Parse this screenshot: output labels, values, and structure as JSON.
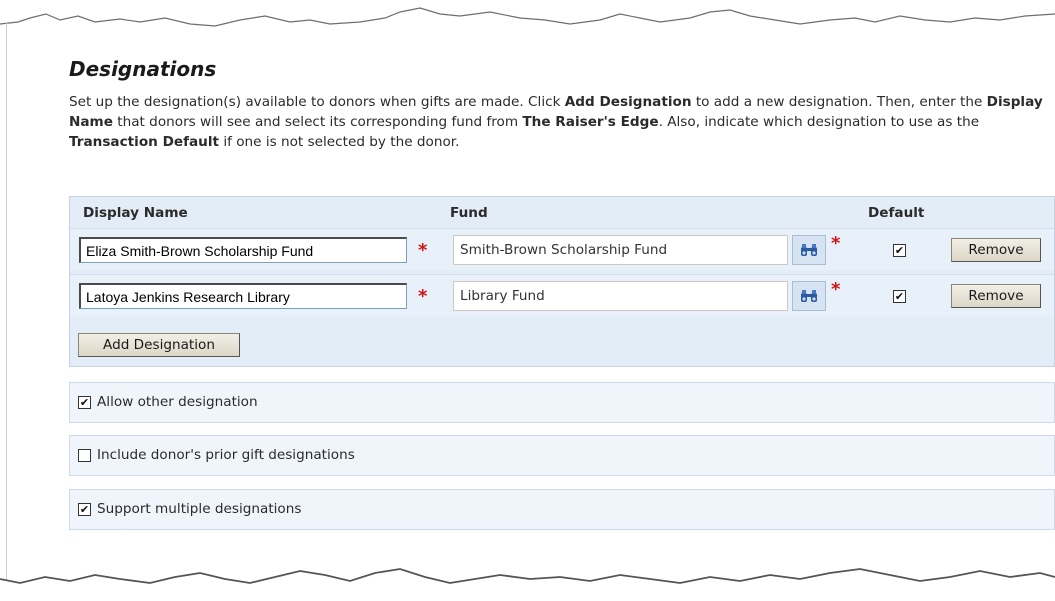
{
  "section": {
    "title": "Designations",
    "description": [
      {
        "text": "Set up the designation(s) available to donors when gifts are made.  Click ",
        "bold": false
      },
      {
        "text": "Add Designation",
        "bold": true
      },
      {
        "text": " to add a new designation.  Then, enter the ",
        "bold": false
      },
      {
        "text": "Display Name",
        "bold": true
      },
      {
        "text": " that donors will see and select its corresponding fund from ",
        "bold": false
      },
      {
        "text": "The Raiser's Edge",
        "bold": true
      },
      {
        "text": ".  Also, indicate which designation to use as the ",
        "bold": false
      },
      {
        "text": "Transaction Default",
        "bold": true
      },
      {
        "text": " if one is not selected by the donor.",
        "bold": false
      }
    ]
  },
  "grid": {
    "headers": {
      "display_name": "Display Name",
      "fund": "Fund",
      "default": "Default"
    },
    "required_marker": "*",
    "rows": [
      {
        "display_name": "Eliza Smith-Brown Scholarship Fund",
        "fund": "Smith-Brown Scholarship Fund",
        "default_checked": true,
        "remove_label": "Remove"
      },
      {
        "display_name": "Latoya Jenkins Research Library",
        "fund": "Library Fund",
        "default_checked": true,
        "remove_label": "Remove"
      }
    ],
    "add_button_label": "Add Designation",
    "lookup_icon": "binoculars-icon"
  },
  "options": [
    {
      "label": "Allow other designation",
      "checked": true
    },
    {
      "label": "Include donor's prior gift designations",
      "checked": false
    },
    {
      "label": "Support multiple designations",
      "checked": true
    }
  ],
  "colors": {
    "panel_bg": "#e3edf8",
    "option_bg": "#f0f5fb",
    "required": "#d01414",
    "lookup_icon": "#2c5aa0"
  }
}
